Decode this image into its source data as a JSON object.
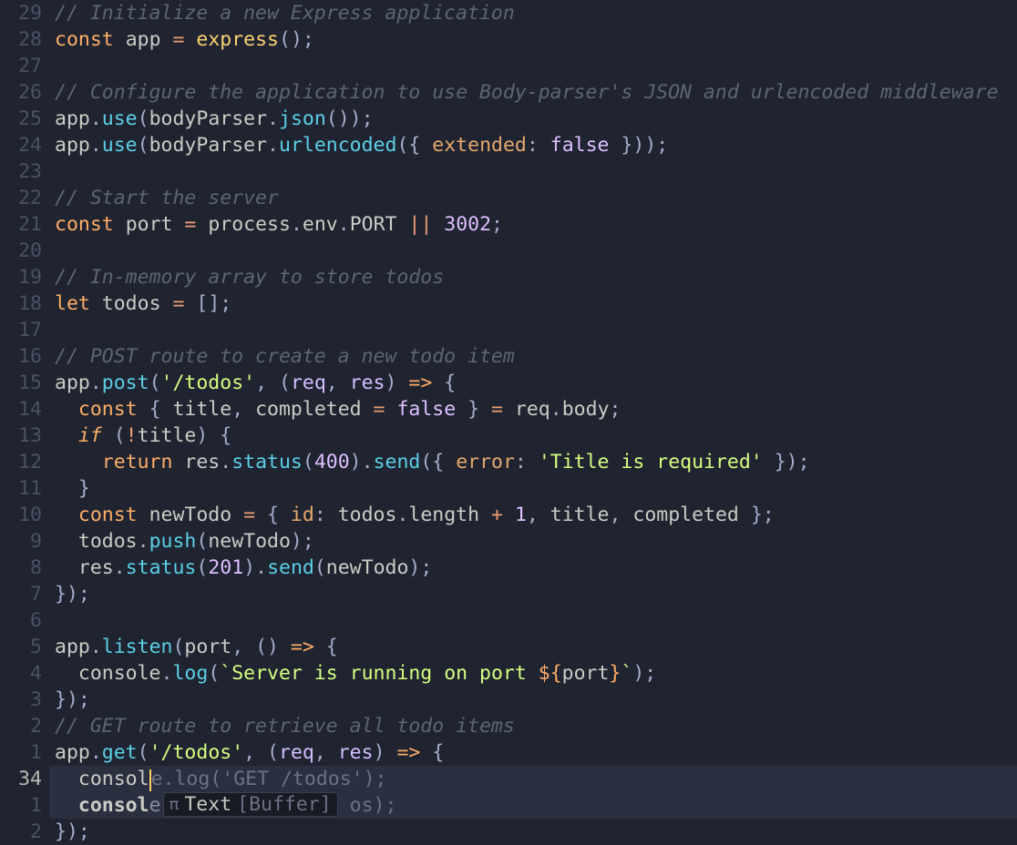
{
  "gutter": [
    "29",
    "28",
    "27",
    "26",
    "25",
    "24",
    "23",
    "22",
    "21",
    "20",
    "19",
    "18",
    "17",
    "16",
    "15",
    "14",
    "13",
    "12",
    "11",
    "10",
    "9",
    "8",
    "7",
    "6",
    "5",
    "4",
    "3",
    "2",
    "1",
    "34",
    "1",
    "2"
  ],
  "lines": {
    "l0": {
      "comment": "// Initialize a new Express application"
    },
    "l1": {
      "const": "const",
      "app": "app",
      "eq": "=",
      "express": "express",
      "paren": "();"
    },
    "l2": {
      "blank": ""
    },
    "l3": {
      "comment": "// Configure the application to use Body-parser's JSON and urlencoded middleware"
    },
    "l4": {
      "app": "app",
      "dot": ".",
      "use": "use",
      "open": "(",
      "bodyParser": "bodyParser",
      "json": "json",
      "close": "());"
    },
    "l5": {
      "app": "app",
      "dot": ".",
      "use": "use",
      "open": "(",
      "bodyParser": "bodyParser",
      "urlencoded": "urlencoded",
      "optopen": "({ ",
      "extended": "extended",
      "colon": ": ",
      "false": "false",
      "close": " }));"
    },
    "l6": {
      "blank": ""
    },
    "l7": {
      "comment": "// Start the server"
    },
    "l8": {
      "const": "const",
      "port": "port",
      "eq": "=",
      "process": "process",
      "dot": ".",
      "env": "env",
      "PORT": "PORT",
      "or": "||",
      "num": "3002",
      "semi": ";"
    },
    "l9": {
      "blank": ""
    },
    "l10": {
      "comment": "// In-memory array to store todos"
    },
    "l11": {
      "let": "let",
      "todos": "todos",
      "eq": "=",
      "arr": "[];"
    },
    "l12": {
      "blank": ""
    },
    "l13": {
      "comment": "// POST route to create a new todo item"
    },
    "l14": {
      "app": "app",
      "dot": ".",
      "post": "post",
      "open": "(",
      "str": "'/todos'",
      "comma": ", ",
      "popen": "(",
      "req": "req",
      "comma2": ", ",
      "res": "res",
      "pclose": ")",
      "arrow": " => ",
      "brace": "{"
    },
    "l15": {
      "indent": "  ",
      "const": "const",
      "destr": "{ ",
      "title": "title",
      "comma": ", ",
      "completed": "completed",
      "eq": " = ",
      "false": "false",
      "destr2": " }",
      "eq2": " = ",
      "req": "req",
      "dot": ".",
      "body": "body",
      "semi": ";"
    },
    "l16": {
      "indent": "  ",
      "if": "if",
      "open": " (",
      "not": "!",
      "title": "title",
      "close": ")",
      "brace": " {"
    },
    "l17": {
      "indent": "    ",
      "return": "return",
      "res": " res",
      "dot": ".",
      "status": "status",
      "open": "(",
      "num": "400",
      "close": ")",
      "dot2": ".",
      "send": "send",
      "open2": "({ ",
      "error": "error",
      "colon": ": ",
      "str": "'Title is required'",
      "close2": " });"
    },
    "l18": {
      "indent": "  ",
      "brace": "}"
    },
    "l19": {
      "indent": "  ",
      "const": "const",
      "newTodo": "newTodo",
      "eq": " = ",
      "open": "{ ",
      "id": "id",
      "colon": ": ",
      "todos": "todos",
      "dot": ".",
      "length": "length",
      "plus": " + ",
      "one": "1",
      "comma": ", ",
      "title": "title",
      "comma2": ", ",
      "completed": "completed",
      "close": " };"
    },
    "l20": {
      "indent": "  ",
      "todos": "todos",
      "dot": ".",
      "push": "push",
      "open": "(",
      "newTodo": "newTodo",
      "close": ");"
    },
    "l21": {
      "indent": "  ",
      "res": "res",
      "dot": ".",
      "status": "status",
      "open": "(",
      "num": "201",
      "close": ")",
      "dot2": ".",
      "send": "send",
      "open2": "(",
      "newTodo": "newTodo",
      "close2": ");"
    },
    "l22": {
      "close": "});"
    },
    "l23": {
      "blank": ""
    },
    "l24": {
      "app": "app",
      "dot": ".",
      "listen": "listen",
      "open": "(",
      "port": "port",
      "comma": ", ",
      "popen": "()",
      "arrow": " => ",
      "brace": "{"
    },
    "l25": {
      "indent": "  ",
      "console": "console",
      "dot": ".",
      "log": "log",
      "open": "(",
      "tmpl1": "`Server is running on port ",
      "tmpl2": "${",
      "port": "port",
      "tmpl3": "}",
      "tmpl4": "`",
      "close": ");"
    },
    "l26": {
      "close": "});"
    },
    "l27": {
      "comment": "// GET route to retrieve all todo items"
    },
    "l28": {
      "app": "app",
      "dot": ".",
      "get": "get",
      "open": "(",
      "str": "'/todos'",
      "comma": ", ",
      "popen": "(",
      "req": "req",
      "comma2": ", ",
      "res": "res",
      "pclose": ")",
      "arrow": " => ",
      "brace": "{"
    },
    "l29": {
      "indent": "  ",
      "consol": "consol",
      "e": "e",
      "dot": ".",
      "log": "log",
      "open": "(",
      "str": "'GET /todos'",
      "close": ");"
    },
    "l30": {
      "indent": "  ",
      "consol": "consol",
      "suffix": "e",
      "kind": "Text",
      "context": "[Buffer]",
      "rest": " os",
      "close": ");"
    },
    "l31": {
      "close": "});"
    }
  },
  "popup": {
    "kind": "Text",
    "context": "[Buffer]"
  }
}
